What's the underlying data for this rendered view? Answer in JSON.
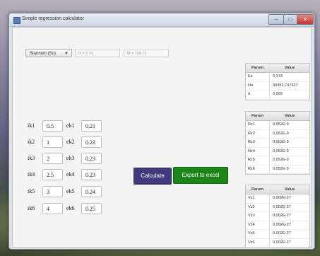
{
  "window": {
    "title": "Simple regression calculator"
  },
  "controls": {
    "element_select": "Stannum (Sn)",
    "field_d": "D = 7.31",
    "field_m": "M = 118.71"
  },
  "inputs": [
    {
      "ik_label": "ik1",
      "ik_value": "0.5",
      "ek_label": "ek1",
      "ek_value": "0.21"
    },
    {
      "ik_label": "ik2",
      "ik_value": "1",
      "ek_label": "ek2",
      "ek_value": "0.23"
    },
    {
      "ik_label": "ik3",
      "ik_value": "2",
      "ek_label": "ek3",
      "ek_value": "0.23"
    },
    {
      "ik_label": "ik4",
      "ik_value": "2.5",
      "ek_label": "ek4",
      "ek_value": "0.23"
    },
    {
      "ik_label": "ik5",
      "ik_value": "3",
      "ek_label": "ek5",
      "ek_value": "0.24"
    },
    {
      "ik_label": "ik6",
      "ik_value": "4",
      "ek_label": "ek6",
      "ek_value": "0.25"
    }
  ],
  "buttons": {
    "calculate": "Calculate",
    "export": "Export to excel"
  },
  "tables": [
    {
      "headers": [
        "Param",
        "Value"
      ],
      "rows": [
        [
          "Ez",
          "0,173"
        ],
        [
          "No",
          "39362,747627"
        ],
        [
          "σ",
          "0,099"
        ]
      ]
    },
    {
      "headers": [
        "Param",
        "Value"
      ],
      "rows": [
        [
          "Rz1",
          "0,052E-9"
        ],
        [
          "Rz2",
          "0,052E-9"
        ],
        [
          "Rz3",
          "0,052E-9"
        ],
        [
          "Rz4",
          "0,052E-9"
        ],
        [
          "Rz5",
          "0,052E-9"
        ],
        [
          "Rz6",
          "0,052E-9"
        ]
      ]
    },
    {
      "headers": [
        "Param",
        "Value"
      ],
      "rows": [
        [
          "Vz1",
          "0,002E-27"
        ],
        [
          "Vz2",
          "0,002E-27"
        ],
        [
          "Vz3",
          "0,002E-27"
        ],
        [
          "Vz4",
          "0,002E-27"
        ],
        [
          "Vz5",
          "0,002E-27"
        ],
        [
          "Vz6",
          "0,002E-27"
        ]
      ]
    }
  ],
  "colors": {
    "calculate_button": "#413a7e",
    "export_button": "#1c8418"
  }
}
